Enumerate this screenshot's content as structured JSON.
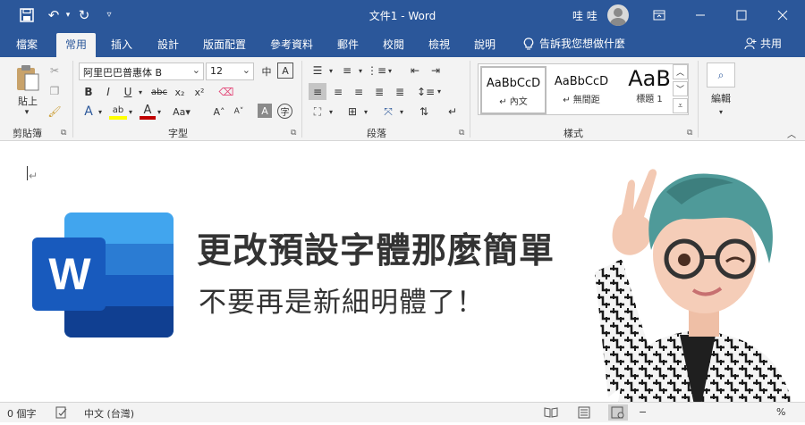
{
  "titlebar": {
    "title": "文件1  -  Word",
    "user_name": "哇 哇",
    "icons": [
      "save-icon",
      "undo-icon",
      "redo-icon",
      "customize-icon",
      "ribbon-display-icon",
      "minimize-icon",
      "maximize-icon",
      "close-icon"
    ]
  },
  "tabs": [
    "檔案",
    "常用",
    "插入",
    "設計",
    "版面配置",
    "參考資料",
    "郵件",
    "校閱",
    "檢視",
    "說明"
  ],
  "active_tab": "常用",
  "tell_me": "告訴我您想做什麼",
  "share": "共用",
  "ribbon": {
    "clipboard": {
      "label": "剪貼簿",
      "paste_label": "貼上"
    },
    "font": {
      "label": "字型",
      "font_name": "阿里巴巴普惠体 B",
      "font_size": "12"
    },
    "paragraph": {
      "label": "段落"
    },
    "styles": {
      "label": "樣式",
      "items": [
        {
          "sample": "AaBbCcD",
          "name": "↵ 內文"
        },
        {
          "sample": "AaBbCcD",
          "name": "↵ 無間距"
        },
        {
          "sample": "AaB",
          "name": "標題 1"
        }
      ]
    },
    "editing": {
      "label": "編輯"
    }
  },
  "document": {
    "headline": "更改預設字體那麼簡單",
    "subline": "不要再是新細明體了！",
    "logo_letter": "W"
  },
  "statusbar": {
    "word_count": "0 個字",
    "language": "中文 (台灣)",
    "zoom": "%"
  },
  "colors": {
    "word_blue": "#2b579a",
    "ribbon_bg": "#f3f3f3",
    "highlight_yellow": "#ffff00",
    "font_color_red": "#c00000"
  }
}
